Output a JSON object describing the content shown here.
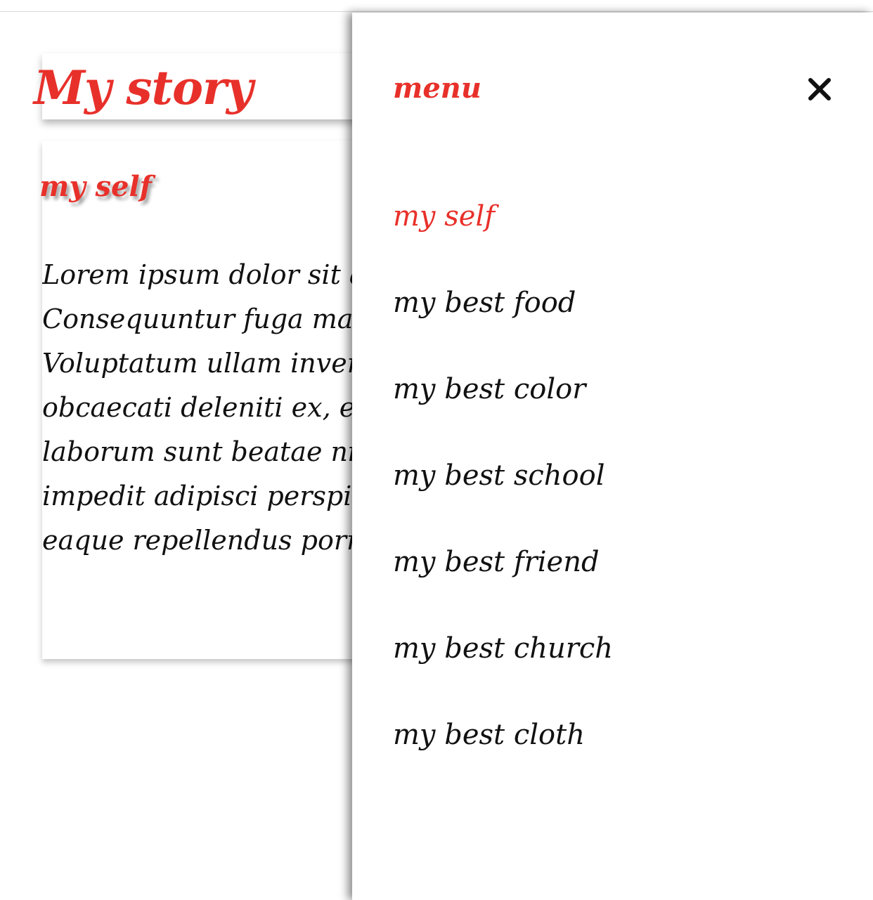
{
  "page": {
    "title": "My story",
    "section_heading": "my self",
    "body_lines": [
      "Lorem ipsum dolor sit am",
      "Consequuntur fuga magna",
      "Voluptatum ullam invento",
      "obcaecati deleniti ex, eum",
      "laborum sunt beatae nisi.",
      "impedit adipisci perspiciat",
      "eaque repellendus porro te"
    ]
  },
  "menu": {
    "title": "menu",
    "close_icon": "close-icon",
    "active_index": 0,
    "items": [
      {
        "label": "my self"
      },
      {
        "label": "my best food"
      },
      {
        "label": "my best color"
      },
      {
        "label": "my best school"
      },
      {
        "label": "my best friend"
      },
      {
        "label": "my best church"
      },
      {
        "label": "my best cloth"
      }
    ]
  },
  "colors": {
    "accent": "#e8302a",
    "text": "#111111",
    "background": "#ffffff"
  }
}
